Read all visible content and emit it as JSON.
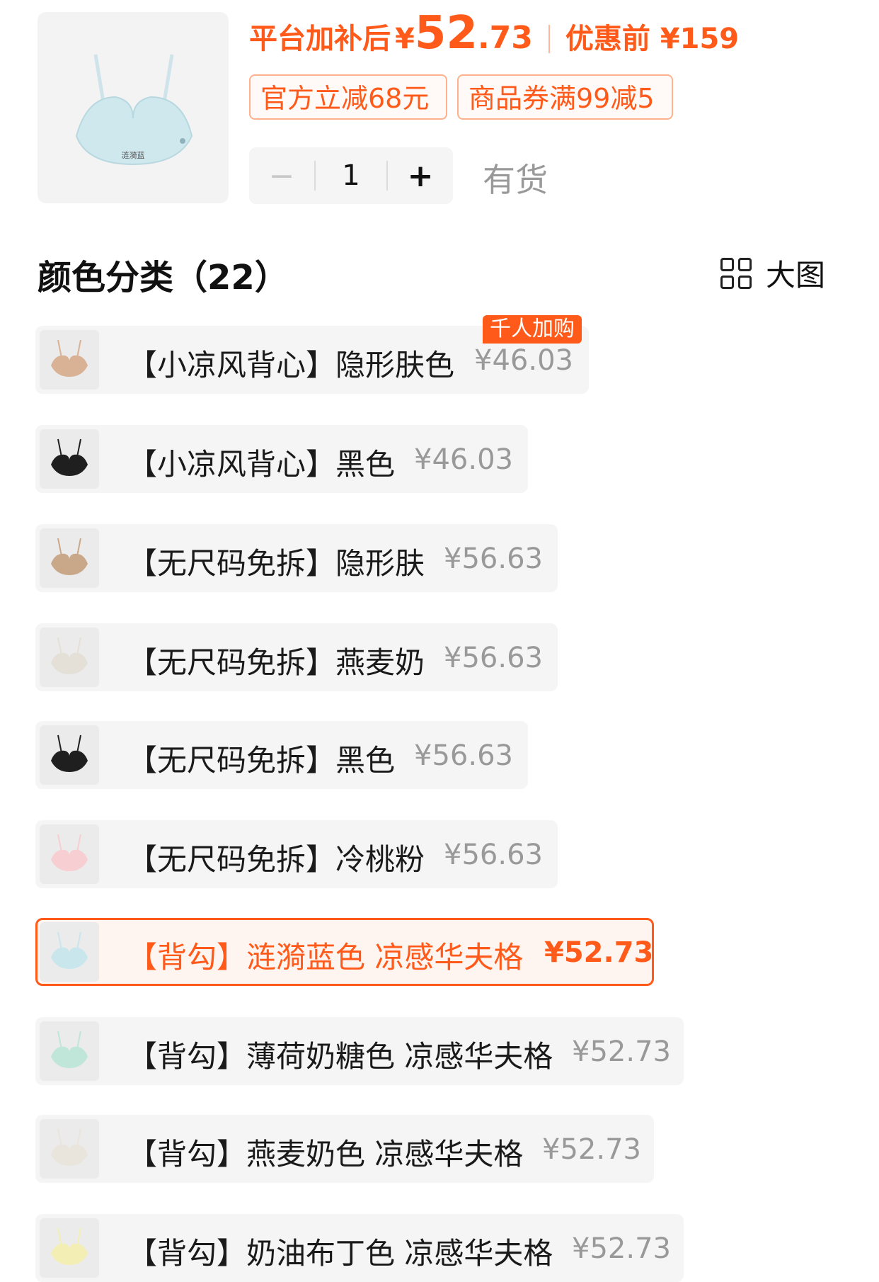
{
  "product": {
    "thumb_caption": "涟漪蓝",
    "price_label": "平台加补后",
    "currency": "¥",
    "price_int": "52",
    "price_dec": ".73",
    "orig_label": "优惠前 ¥159",
    "coupons": [
      "官方立减68元",
      "商品券满99减5"
    ],
    "quantity": "1",
    "minus_label": "−",
    "plus_label": "+",
    "stock": "有货"
  },
  "section": {
    "title": "颜色分类（22）",
    "view_label": "大图"
  },
  "badge": "千人加购",
  "options": [
    {
      "name": "【小凉风背心】隐形肤色",
      "price": "¥46.03",
      "color": "#d9b194"
    },
    {
      "name": "【小凉风背心】黑色",
      "price": "¥46.03",
      "color": "#1f1f1f"
    },
    {
      "name": "【无尺码免拆】隐形肤",
      "price": "¥56.63",
      "color": "#c9a88a"
    },
    {
      "name": "【无尺码免拆】燕麦奶",
      "price": "¥56.63",
      "color": "#e4e0d8"
    },
    {
      "name": "【无尺码免拆】黑色",
      "price": "¥56.63",
      "color": "#1f1f1f"
    },
    {
      "name": "【无尺码免拆】冷桃粉",
      "price": "¥56.63",
      "color": "#f7cfd3"
    },
    {
      "name": "【背勾】涟漪蓝色 凉感华夫格",
      "price": "¥52.73",
      "color": "#c9e6ec",
      "selected": true
    },
    {
      "name": "【背勾】薄荷奶糖色 凉感华夫格",
      "price": "¥52.73",
      "color": "#bfe6d8"
    },
    {
      "name": "【背勾】燕麦奶色 凉感华夫格",
      "price": "¥52.73",
      "color": "#e9e5dd"
    },
    {
      "name": "【背勾】奶油布丁色 凉感华夫格",
      "price": "¥52.73",
      "color": "#f3efb4"
    }
  ],
  "colors": {
    "accent": "#ff5a1a",
    "row_bg": "#f5f5f5",
    "muted": "#999999"
  }
}
